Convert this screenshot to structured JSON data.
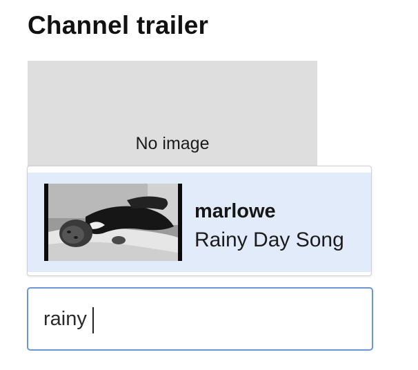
{
  "section": {
    "title": "Channel trailer"
  },
  "trailer_preview": {
    "placeholder_text": "No image"
  },
  "suggestions": {
    "items": [
      {
        "channel": "marlowe",
        "title": "Rainy Day Song",
        "thumbnail_icon": "video-thumbnail-image"
      }
    ]
  },
  "search": {
    "value": "rainy",
    "placeholder": ""
  },
  "colors": {
    "suggestion_highlight": "#e1ebfa",
    "input_focus_border": "#6a96d6",
    "placeholder_bg": "#dedede"
  }
}
